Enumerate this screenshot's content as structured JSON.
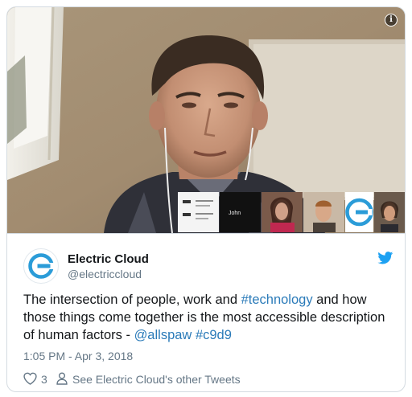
{
  "media": {
    "info_icon": "info-icon",
    "thumbnails": [
      {
        "name": "",
        "kind": "slide"
      },
      {
        "name": "John",
        "kind": "dark"
      },
      {
        "name": "",
        "kind": "woman"
      },
      {
        "name": "",
        "kind": "man"
      },
      {
        "name": "",
        "kind": "logo"
      },
      {
        "name": "",
        "kind": "woman-2"
      }
    ]
  },
  "tweet": {
    "author_name": "Electric Cloud",
    "author_handle": "@electriccloud",
    "text_plain": "The intersection of people, work and ",
    "hashtag_1": "#technology",
    "text_plain_2": " and how those things come together is the most accessible description of human factors - ",
    "mention": "@allspaw",
    "hashtag_2": "#c9d9",
    "timestamp": "1:05 PM - Apr 3, 2018",
    "like_count": "3",
    "other_tweets_label": "See Electric Cloud's other Tweets"
  },
  "colors": {
    "link": "#2b7bb9",
    "twitter_blue": "#1da1f2",
    "logo_blue": "#2b9cd8",
    "muted": "#657786",
    "text": "#14171a"
  },
  "icons": {
    "brand": "twitter-bird-icon",
    "like": "heart-icon",
    "profile": "person-icon",
    "avatar_logo": "electric-cloud-logo"
  }
}
